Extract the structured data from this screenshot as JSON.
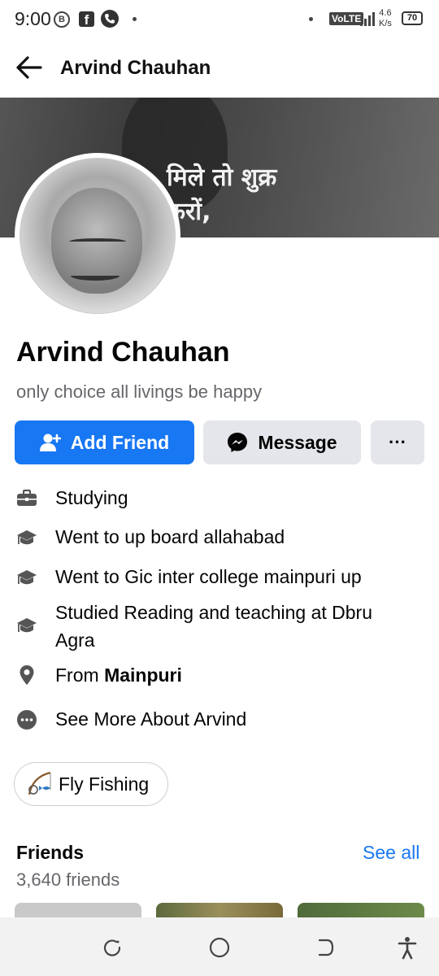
{
  "status_bar": {
    "time": "9:00",
    "b_icon": "B",
    "network_type": "VoLTE",
    "net_speed_value": "4.6",
    "net_speed_unit": "K/s",
    "battery": "70"
  },
  "header": {
    "title": "Arvind Chauhan"
  },
  "cover": {
    "text": "मिले तो शुक्र\nकरों,"
  },
  "profile": {
    "name": "Arvind Chauhan",
    "bio": "only choice all livings be happy"
  },
  "actions": {
    "add_friend": "Add Friend",
    "message": "Message",
    "more": "···"
  },
  "details": [
    {
      "icon": "briefcase-icon",
      "text": "Studying"
    },
    {
      "icon": "graduation-cap-icon",
      "text": "Went to up board allahabad"
    },
    {
      "icon": "graduation-cap-icon",
      "text": "Went to Gic inter college mainpuri up"
    },
    {
      "icon": "graduation-cap-icon",
      "text": "Studied Reading and teaching at Dbru Agra"
    },
    {
      "icon": "location-pin-icon",
      "prefix": "From ",
      "bold": "Mainpuri"
    },
    {
      "icon": "more-dots-icon",
      "text": "See More About Arvind"
    }
  ],
  "hobby": {
    "icon": "fishing-icon",
    "label": "Fly Fishing"
  },
  "friends": {
    "title": "Friends",
    "see_all": "See all",
    "count": "3,640 friends"
  },
  "colors": {
    "accent": "#1877f2",
    "secondary_button": "#e4e6eb",
    "muted_text": "#65676b"
  }
}
